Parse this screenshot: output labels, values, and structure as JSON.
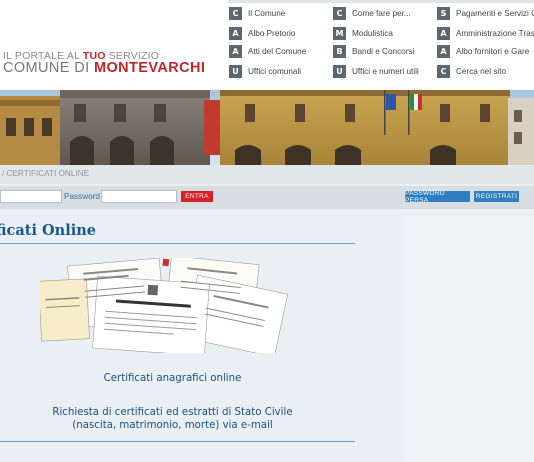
{
  "header": {
    "tagline_pre": "IL PORTALE AL ",
    "tagline_hl": "TUO",
    "tagline_post": " SERVIZIO",
    "brand_pre": "COMUNE DI ",
    "brand_hl": "MONTEVARCHI"
  },
  "nav": [
    {
      "letter": "C",
      "label": "Il Comune"
    },
    {
      "letter": "A",
      "label": "Albo Pretorio"
    },
    {
      "letter": "A",
      "label": "Atti del Comune"
    },
    {
      "letter": "U",
      "label": "Uffici comunali"
    },
    {
      "letter": "C",
      "label": "Come fare per..."
    },
    {
      "letter": "M",
      "label": "Modulistica"
    },
    {
      "letter": "B",
      "label": "Bandi e Concorsi"
    },
    {
      "letter": "U",
      "label": "Uffici e numeri utili"
    },
    {
      "letter": "S",
      "label": "Pagamenti e Servizi O"
    },
    {
      "letter": "A",
      "label": "Amministrazione Tras"
    },
    {
      "letter": "A",
      "label": "Albo fornitori e Gare"
    },
    {
      "letter": "C",
      "label": "Cerca nel sito"
    }
  ],
  "breadcrumb": "/  CERTIFICATI ONLINE",
  "login": {
    "password_label": "Password",
    "enter_label": "ENTRA",
    "lost_password_label": "PASSWORD PERSA",
    "register_label": "REGISTRATI"
  },
  "colors": {
    "brand_red": "#c5262b",
    "link_blue": "#1a4f86",
    "button_blue": "#2f7fc0",
    "button_red": "#d6232a"
  },
  "main": {
    "heading": "ficati Online",
    "link1": "Certificati anagrafici online",
    "link2_line1": "Richiesta di certificati ed estratti di Stato Civile",
    "link2_line2": "(nascita, matrimonio, morte) via e-mail"
  }
}
